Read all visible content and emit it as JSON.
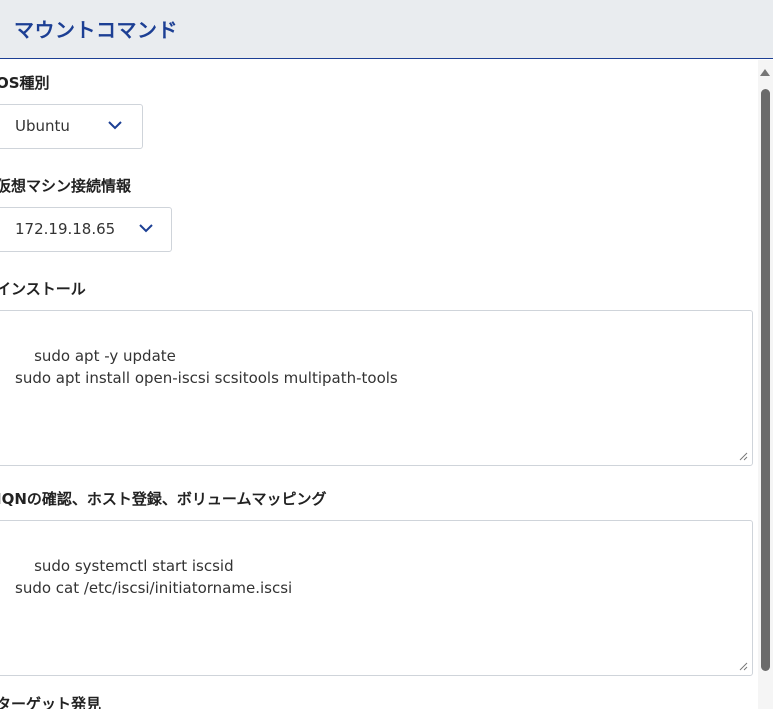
{
  "header": {
    "title": "マウントコマンド"
  },
  "os_type": {
    "label": "OS種別",
    "selected": "Ubuntu"
  },
  "vm_info": {
    "label": "仮想マシン接続情報",
    "selected": "172.19.18.65"
  },
  "install": {
    "label": "インストール",
    "command": "sudo apt -y update\nsudo apt install open-iscsi scsitools multipath-tools"
  },
  "iqn": {
    "label": "IQNの確認、ホスト登録、ボリュームマッピング",
    "command": "sudo systemctl start iscsid\nsudo cat /etc/iscsi/initiatorname.iscsi"
  },
  "target": {
    "label": "ターゲット発見"
  },
  "icons": {
    "dropdown": "chevron-down-icon",
    "resize": "resize-grip-icon",
    "scroll_up": "scroll-up-arrow-icon"
  },
  "colors": {
    "accent": "#1c3f94",
    "header_bg": "#e9ecef"
  }
}
